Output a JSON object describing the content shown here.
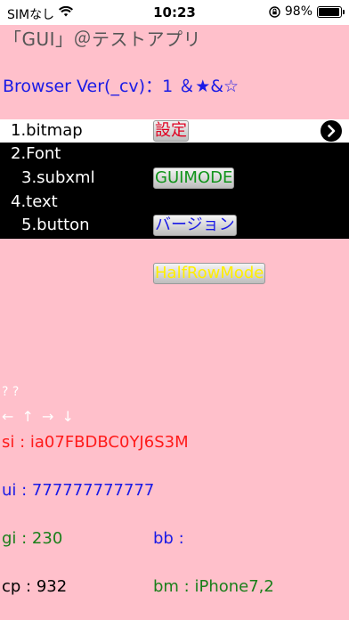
{
  "status_bar": {
    "carrier": "SIMなし",
    "time": "10:23",
    "battery": "98%"
  },
  "header": {
    "title": "「GUI」＠テストアプリ",
    "browser_ver": "Browser Ver(_cv)：1 ＆★&☆"
  },
  "menu": {
    "items": [
      {
        "label": "1.bitmap"
      },
      {
        "label": "2.Font"
      },
      {
        "label": "3.subxml"
      },
      {
        "label": "4.text"
      },
      {
        "label": "5.button"
      }
    ],
    "buttons": {
      "settings": "設定",
      "guimode": "GUIMODE",
      "version": "バージョン"
    }
  },
  "half_row_mode_button": "HalfRowMode",
  "debug": {
    "question_marks": "? ?",
    "arrows": "← ↑ → ↓"
  },
  "info": {
    "si": "si : ia07FBDBC0YJ6S3M",
    "ui": "ui : 777777777777",
    "gi": "gi : 230",
    "bb": "bb :",
    "cp": "cp : 932",
    "bm": "bm : iPhone7,2"
  },
  "colors": {
    "background": "#ffc0cb",
    "menu_bg": "#000000",
    "selected_bg": "#ffffff",
    "red": "#ff1a1a",
    "blue": "#1a1ae6",
    "green": "#1a7f1a"
  },
  "icons": {
    "chevron": "chevron-right-circle-icon",
    "wifi": "wifi-icon",
    "lock": "rotation-lock-icon",
    "battery": "battery-icon"
  }
}
